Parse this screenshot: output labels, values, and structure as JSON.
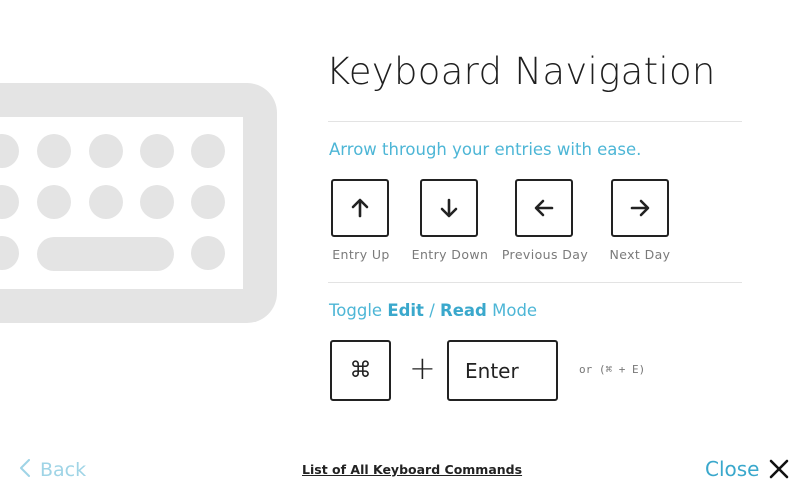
{
  "illustration": {
    "icon": "keyboard-illustration"
  },
  "header": {
    "title": "Keyboard Navigation"
  },
  "arrows": {
    "subtitle": "Arrow through your entries with ease.",
    "keys": [
      {
        "icon": "arrow-up-icon",
        "label": "Entry Up"
      },
      {
        "icon": "arrow-down-icon",
        "label": "Entry Down"
      },
      {
        "icon": "arrow-left-icon",
        "label": "Previous Day"
      },
      {
        "icon": "arrow-right-icon",
        "label": "Next Day"
      }
    ]
  },
  "toggle": {
    "prefix": "Toggle",
    "edit": "Edit",
    "sep": "/",
    "read": "Read",
    "suffix": "Mode",
    "cmd_glyph": "⌘",
    "plus": "+",
    "enter": "Enter",
    "alternative": "or (⌘ + E)"
  },
  "footer": {
    "back": "Back",
    "back_icon": "chevron-left-icon",
    "list_link": "List of All Keyboard Commands",
    "close": "Close",
    "close_icon": "close-icon"
  },
  "colors": {
    "accent": "#4db6d6",
    "back": "#9fd4e6",
    "key_border": "#222222",
    "illustration": "#e4e4e4"
  }
}
